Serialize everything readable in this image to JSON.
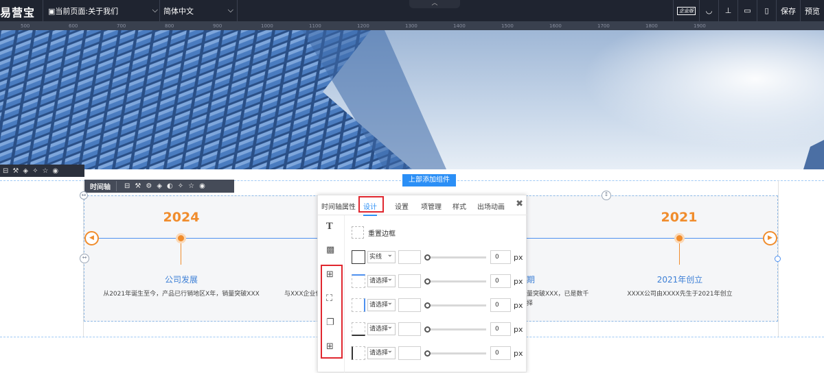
{
  "topbar": {
    "logo": "易营宝",
    "current_page": "当前页面:关于我们",
    "language": "简体中文",
    "enterprise_badge": "企业版",
    "save_label": "保存",
    "preview_label": "预览",
    "icons": [
      "enterprise-icon",
      "hide-icon",
      "layout-icon",
      "desktop-icon",
      "mobile-icon"
    ]
  },
  "ruler": {
    "marks": [
      "500",
      "600",
      "700",
      "800",
      "900",
      "1000",
      "1100",
      "1200",
      "1300",
      "1400",
      "1500",
      "1600",
      "1700",
      "1800",
      "1900"
    ]
  },
  "component_toolbar": {
    "label": "时间轴"
  },
  "add_button": "上部添加组件",
  "timeline": {
    "items": [
      {
        "year": "2024",
        "title": "公司发展",
        "desc": "从2021年诞生至今，产品已行销地区X年，销量突破XXX"
      },
      {
        "year": "",
        "title": "",
        "desc": "与XXX企业保"
      },
      {
        "year": "",
        "title": "期",
        "desc": "量突破XXX，已是数千\n择"
      },
      {
        "year": "2021",
        "title": "2021年创立",
        "desc": "XXXX公司由XXXX先生于2021年创立"
      }
    ],
    "accent_color": "#f08c2c",
    "line_color": "#4d90f0"
  },
  "panel": {
    "tabs": [
      "时间轴属性",
      "设计",
      "设置",
      "项管理",
      "样式",
      "出场动画"
    ],
    "active_tab": "设计",
    "reset_border": "重置边框",
    "rows": [
      {
        "style": "实线",
        "value": "0",
        "unit": "px"
      },
      {
        "style": "请选择",
        "value": "0",
        "unit": "px"
      },
      {
        "style": "请选择",
        "value": "0",
        "unit": "px"
      },
      {
        "style": "请选择",
        "value": "0",
        "unit": "px"
      },
      {
        "style": "请选择",
        "value": "0",
        "unit": "px"
      }
    ],
    "side_icons": [
      "text-icon",
      "background-icon",
      "border-icon",
      "padding-icon",
      "shadow-icon",
      "margin-icon"
    ]
  }
}
